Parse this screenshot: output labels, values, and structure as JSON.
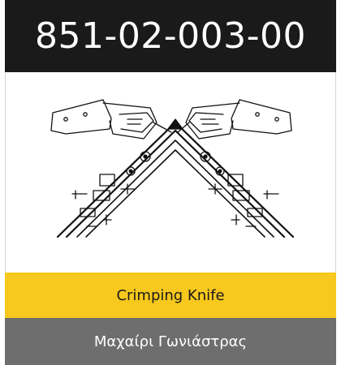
{
  "product": {
    "code": "851-02-003-00",
    "name_en": "Crimping Knife",
    "name_gr": "Μαχαίρι Γωνιάστρας"
  },
  "colors": {
    "header_bg": "#1a1a1a",
    "caption_en_bg": "#f7c81d",
    "caption_gr_bg": "#6e6e6e"
  },
  "image": {
    "icon": "crimping-knife-drawing"
  }
}
